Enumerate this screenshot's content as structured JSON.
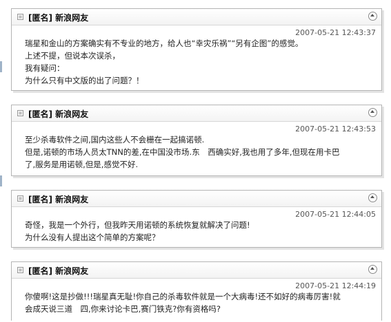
{
  "comments": [
    {
      "author": "[匿名] 新浪网友",
      "time": "2007-05-21 12:43:37",
      "lines": [
        "瑞星和金山的方案确实有不专业的地方，给人也“幸灾乐祸”“另有企图”的感觉。",
        "上述不提，但说本次误杀，",
        "我有疑问：",
        "为什么只有中文版的出了问题？！"
      ]
    },
    {
      "author": "[匿名] 新浪网友",
      "time": "2007-05-21 12:43:53",
      "lines": [
        "至少杀毒软件之间,国内这些人不会栅在一起搞诺顿.",
        "但是,诺顿的市场人员太TNN的差,在中国没市场.东　西确实好,我也用了多年,但现在用卡巴",
        "了,服务是用诺顿,但是,感觉不好."
      ]
    },
    {
      "author": "[匿名] 新浪网友",
      "time": "2007-05-21 12:44:05",
      "lines": [
        "奇怪，我是一个外行，但我昨天用诺顿的系统恢复就解决了问题!",
        "为什么没有人提出这个简单的方案呢？"
      ]
    },
    {
      "author": "[匿名] 新浪网友",
      "time": "2007-05-21 12:44:19",
      "lines": [
        "你傻啊!这是抄做!!!瑞星真无耻!你自己的杀毒软件就是一个大病毒!还不如好的病毒厉害!就",
        "会成天说三道　四,你来讨论卡巴,赛门铁克?你有资格吗?"
      ]
    }
  ]
}
